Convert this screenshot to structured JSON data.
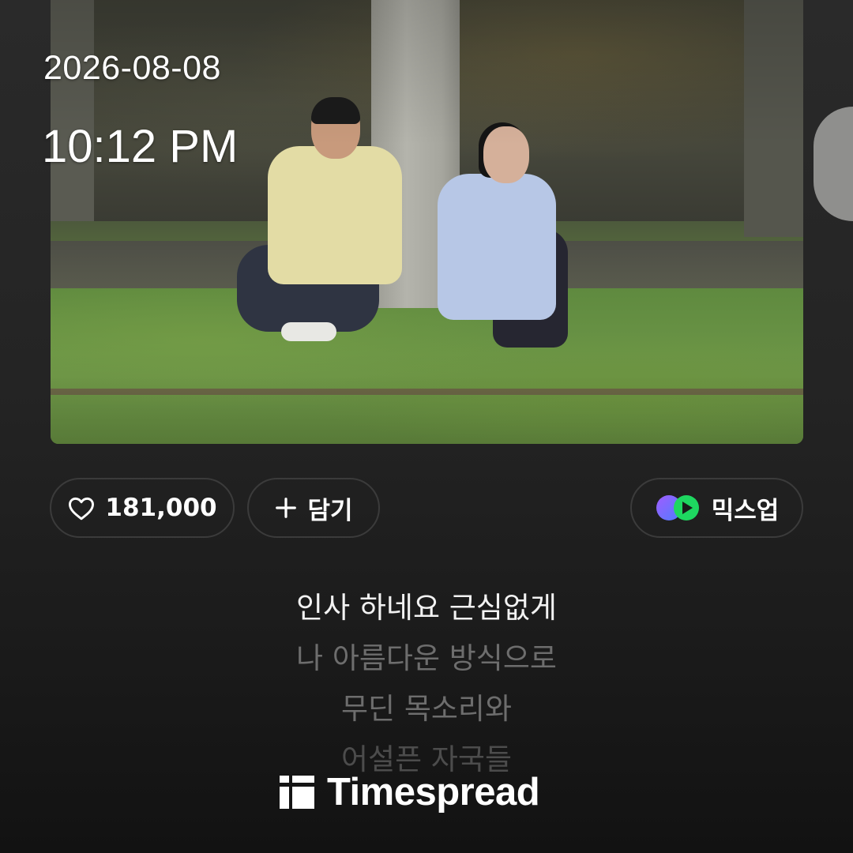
{
  "overlay": {
    "date": "2026-08-08",
    "time": "10:12 PM"
  },
  "actions": {
    "like": {
      "icon": "heart-outline-icon",
      "count": "181,000"
    },
    "add": {
      "icon": "plus-icon",
      "label": "담기"
    },
    "mixup": {
      "icon": "mixup-logo-icon",
      "label": "믹스업"
    }
  },
  "lyrics": [
    "인사 하네요 근심없게",
    "나 아름다운 방식으로",
    "무딘 목소리와",
    "어설픈 자국들"
  ],
  "watermark": {
    "text": "Timespread",
    "icon": "timespread-logo-icon"
  },
  "colors": {
    "background": "#191919",
    "chip_border": "#3b3b3b",
    "lyric_active": "#f2f2f2",
    "lyric_dim": "#6d6d6d",
    "mixup_purple": "#7b5cff",
    "mixup_green": "#1ed760"
  }
}
